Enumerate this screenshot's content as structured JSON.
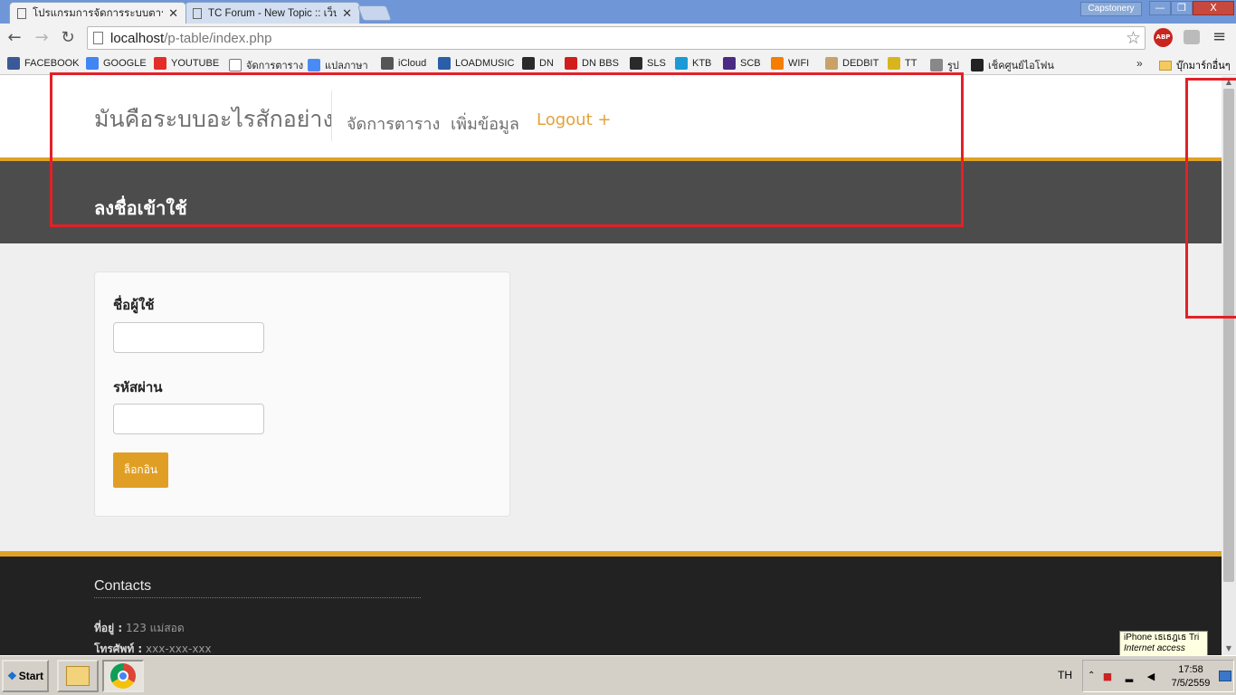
{
  "browser": {
    "tabs": [
      {
        "title": "โปรแกรมการจัดการระบบตาราง"
      },
      {
        "title": "TC Forum - New Topic :: เว็บ"
      }
    ],
    "profile_name": "Capstonery",
    "window_buttons": {
      "minimize": "—",
      "maximize": "❐",
      "close": "X"
    },
    "url_host": "localhost",
    "url_path": "/p-table/index.php",
    "extensions": {
      "adblock": "ABP"
    },
    "bookmarks": [
      {
        "label": "FACEBOOK",
        "icon": "facebook-icon",
        "color": "#3b5998"
      },
      {
        "label": "GOOGLE",
        "icon": "google-icon",
        "color": "#4285f4"
      },
      {
        "label": "YOUTUBE",
        "icon": "youtube-icon",
        "color": "#e52d27"
      },
      {
        "label": "จัดการตาราง",
        "icon": "page-icon",
        "color": "#ffffff"
      },
      {
        "label": "แปลภาษา",
        "icon": "translate-icon",
        "color": "#4a8af4"
      },
      {
        "label": "iCloud",
        "icon": "apple-icon",
        "color": "#555555"
      },
      {
        "label": "LOADMUSIC",
        "icon": "yt-mp3-icon",
        "color": "#2b5ea8"
      },
      {
        "label": "DN",
        "icon": "dn-icon",
        "color": "#2a2a2a"
      },
      {
        "label": "DN BBS",
        "icon": "dn-bbs-icon",
        "color": "#d21d1d"
      },
      {
        "label": "SLS",
        "icon": "sls-icon",
        "color": "#2a2a2a"
      },
      {
        "label": "KTB",
        "icon": "ktb-icon",
        "color": "#1c9ad6"
      },
      {
        "label": "SCB",
        "icon": "scb-icon",
        "color": "#4b2a83"
      },
      {
        "label": "WIFI",
        "icon": "blogger-icon",
        "color": "#f57d00"
      },
      {
        "label": "DEDBIT",
        "icon": "dedbit-icon",
        "color": "#c9a268"
      },
      {
        "label": "TT",
        "icon": "tt-icon",
        "color": "#d8b51d"
      },
      {
        "label": "รูป",
        "icon": "photo-icon",
        "color": "#888888"
      },
      {
        "label": "เช็คศูนย์ไอโฟน",
        "icon": "iphone-icon",
        "color": "#222222"
      }
    ],
    "other_bookmarks": "บุ๊กมาร์กอื่นๆ"
  },
  "site": {
    "brand": "มันคือระบบอะไรสักอย่าง",
    "nav": [
      "จัดการตาราง",
      "เพิ่มข้อมูล",
      "Logout +"
    ],
    "page_title": "ลงชื่อเข้าใช้",
    "accent_color": "#e0a226"
  },
  "login_form": {
    "username_label": "ชื่อผู้ใช้",
    "username_value": "",
    "password_label": "รหัสผ่าน",
    "password_value": "",
    "submit_label": "ล็อกอิน"
  },
  "footer": {
    "heading": "Contacts",
    "address_label": "ที่อยู่ :",
    "address_value": "123 แม่สอด",
    "phone_label": "โทรศัพท์ :",
    "phone_value": "xxx-xxx-xxx"
  },
  "tooltip": {
    "line1": "iPhone เธเธฎเธ Tri",
    "line2": "Internet access"
  },
  "taskbar": {
    "start_label": "Start",
    "language": "TH",
    "time": "17:58",
    "date": "7/5/2559"
  }
}
